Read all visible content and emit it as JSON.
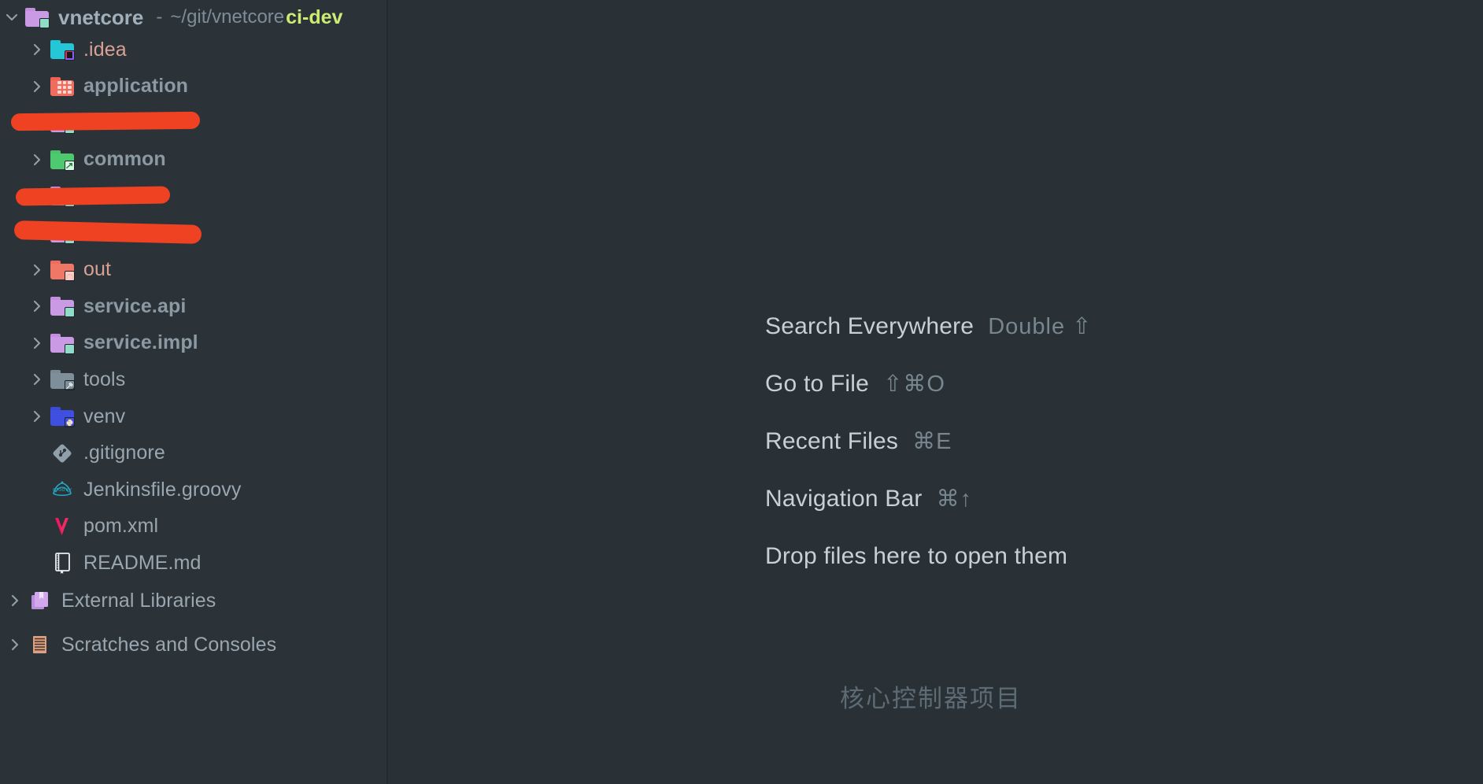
{
  "window": {
    "background": "#293036",
    "sidebar_background": "#2b3238",
    "accent_branch_color": "#cdec74",
    "redaction_color": "#ef4223"
  },
  "sidebar": {
    "root": {
      "name": "vnetcore",
      "separator": "-",
      "path": "~/git/vnetcore",
      "branch": "ci-dev",
      "icon": "folder-module-icon",
      "expanded": true
    },
    "items": [
      {
        "label": ".idea",
        "icon": "folder-idea-icon",
        "expandable": true,
        "style": "salmon",
        "redacted": false
      },
      {
        "label": "application",
        "icon": "folder-application-icon",
        "expandable": true,
        "style": "bold",
        "redacted": false
      },
      {
        "label": "",
        "icon": "folder-module-icon",
        "expandable": true,
        "style": "bold",
        "redacted": true
      },
      {
        "label": "common",
        "icon": "folder-source-icon",
        "expandable": true,
        "style": "bold",
        "redacted": false
      },
      {
        "label": "",
        "icon": "folder-module-icon",
        "expandable": true,
        "style": "bold",
        "redacted": true
      },
      {
        "label": "",
        "icon": "folder-module-icon",
        "expandable": true,
        "style": "bold",
        "redacted": true
      },
      {
        "label": "out",
        "icon": "folder-excluded-icon",
        "expandable": true,
        "style": "salmon",
        "redacted": false
      },
      {
        "label": "service.api",
        "icon": "folder-module-icon",
        "expandable": true,
        "style": "bold",
        "redacted": false
      },
      {
        "label": "service.impl",
        "icon": "folder-module-icon",
        "expandable": true,
        "style": "bold",
        "redacted": false
      },
      {
        "label": "tools",
        "icon": "folder-tools-icon",
        "expandable": true,
        "style": "plain",
        "redacted": false
      },
      {
        "label": "venv",
        "icon": "folder-python-icon",
        "expandable": true,
        "style": "plain",
        "redacted": false
      },
      {
        "label": ".gitignore",
        "icon": "git-file-icon",
        "expandable": false,
        "style": "plain",
        "redacted": false
      },
      {
        "label": "Jenkinsfile.groovy",
        "icon": "groovy-file-icon",
        "expandable": false,
        "style": "plain",
        "redacted": false
      },
      {
        "label": "pom.xml",
        "icon": "maven-file-icon",
        "expandable": false,
        "style": "plain",
        "redacted": false
      },
      {
        "label": "README.md",
        "icon": "markdown-file-icon",
        "expandable": false,
        "style": "plain",
        "redacted": false
      }
    ],
    "bottom_nodes": [
      {
        "label": "External Libraries",
        "icon": "external-libraries-icon",
        "expandable": true
      },
      {
        "label": "Scratches and Consoles",
        "icon": "scratches-icon",
        "expandable": true
      }
    ]
  },
  "main": {
    "shortcuts": [
      {
        "label": "Search Everywhere",
        "keys": "Double ⇧"
      },
      {
        "label": "Go to File",
        "keys": "⇧⌘O"
      },
      {
        "label": "Recent Files",
        "keys": "⌘E"
      },
      {
        "label": "Navigation Bar",
        "keys": "⌘↑"
      }
    ],
    "drop_hint": "Drop files here to open them",
    "annotation": "核心控制器项目"
  }
}
